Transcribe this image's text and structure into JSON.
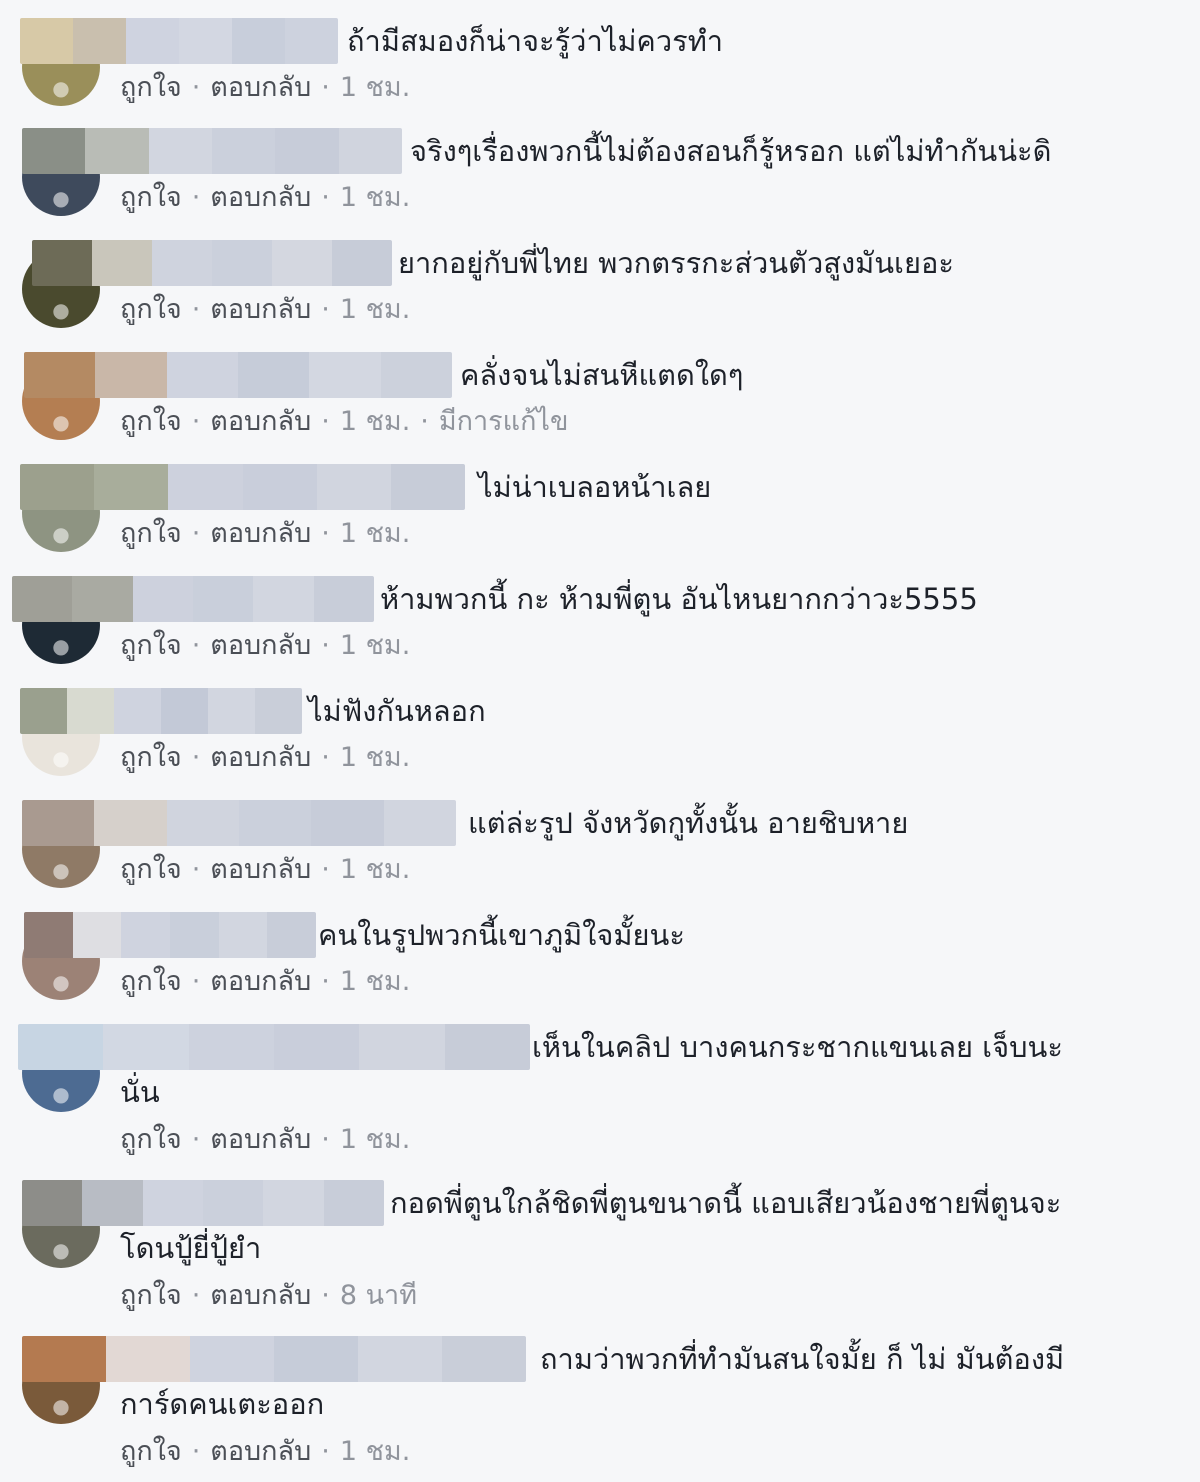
{
  "labels": {
    "like": "ถูกใจ",
    "reply": "ตอบกลับ",
    "edited": "มีการแก้ไข"
  },
  "comments": [
    {
      "text": "ถ้ามีสมองก็น่าจะรู้ว่าไม่ควรทำ",
      "time": "1 ชม."
    },
    {
      "text": "จริงๆเรื่องพวกนี้ไม่ต้องสอนก็รู้หรอก แต่ไม่ทำกันน่ะดิ",
      "time": "1 ชม."
    },
    {
      "text": "ยากอยู่กับพี่ไทย พวกตรรกะส่วนตัวสูงมันเยอะ",
      "time": "1 ชม."
    },
    {
      "text": "คลั่งจนไม่สนหีแตดใดๆ",
      "time": "1 ชม.",
      "edited": true
    },
    {
      "text": "ไม่น่าเบลอหน้าเลย",
      "time": "1 ชม."
    },
    {
      "text": "ห้ามพวกนี้ กะ ห้ามพี่ตูน อันไหนยากกว่าวะ5555",
      "time": "1 ชม."
    },
    {
      "text": "ไม่ฟังกันหลอก",
      "time": "1 ชม."
    },
    {
      "text": "แต่ล่ะรูป จังหวัดกูทั้งนั้น อายชิบหาย",
      "time": "1 ชม."
    },
    {
      "text": "คนในรูปพวกนี้เขาภูมิใจมั้ยนะ",
      "time": "1 ชม."
    },
    {
      "text": "เห็นในคลิป บางคนกระชากแขนเลย เจ็บนะ",
      "text_cont": "นั่น",
      "time": "1 ชม."
    },
    {
      "text": "กอดพี่ตูนใกล้ชิดพี่ตูนขนาดนี้ แอบเสียวน้องชายพี่ตูนจะ",
      "text_cont": "โดนปู้ยี่ปู้ยำ",
      "time": "8 นาที"
    },
    {
      "text": "ถามว่าพวกที่ทำมันสนใจมั้ย ก็ ไม่ มันต้องมี",
      "text_cont": "การ์ดคนเตะออก",
      "time": "1 ชม."
    }
  ],
  "colors": {
    "background": "#f6f7f9",
    "text": "#1d2129",
    "meta": "#90949c",
    "link": "#4b4f56",
    "blur": "#c9cfdc"
  }
}
